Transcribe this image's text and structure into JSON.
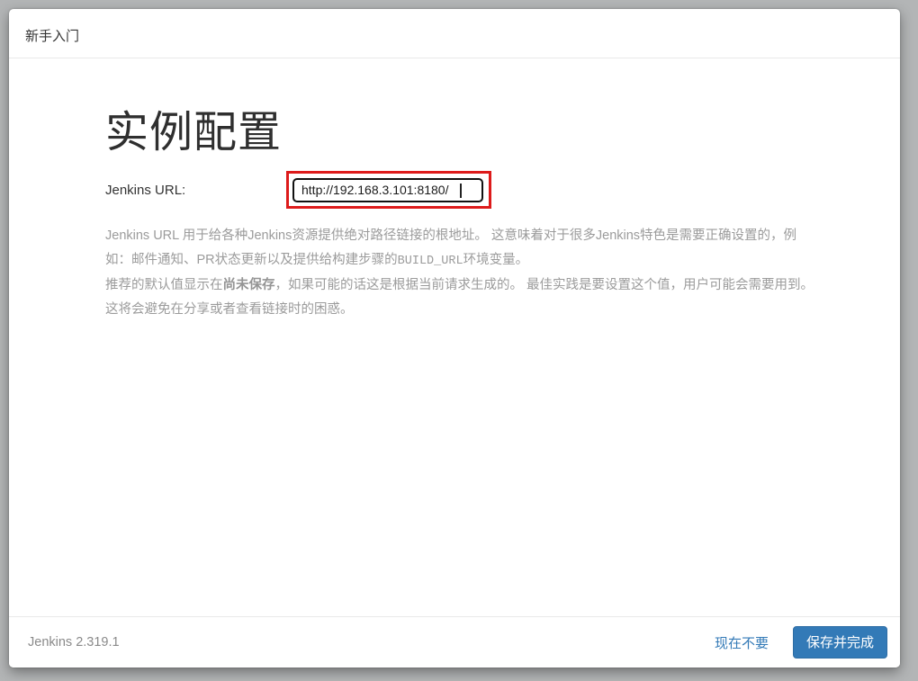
{
  "window": {
    "title": "新手入门"
  },
  "main": {
    "heading": "实例配置",
    "form": {
      "label": "Jenkins URL:",
      "input_value": "http://192.168.3.101:8180/"
    },
    "help": {
      "p1_before_code": "Jenkins URL 用于给各种Jenkins资源提供绝对路径链接的根地址。 这意味着对于很多Jenkins特色是需要正确设置的，例如：邮件通知、PR状态更新以及提供给构建步骤的",
      "p1_code": "BUILD_URL",
      "p1_after_code": "环境变量。",
      "p2_before_bold": "推荐的默认值显示在",
      "p2_bold": "尚未保存",
      "p2_after_bold": "，如果可能的话这是根据当前请求生成的。 最佳实践是要设置这个值，用户可能会需要用到。这将会避免在分享或者查看链接时的困惑。"
    }
  },
  "footer": {
    "version": "Jenkins 2.319.1",
    "not_now_label": "现在不要",
    "save_label": "保存并完成"
  },
  "colors": {
    "accent_blue": "#337ab7",
    "highlight_red": "#dd1b1b",
    "page_background": "#b3b5b6"
  }
}
